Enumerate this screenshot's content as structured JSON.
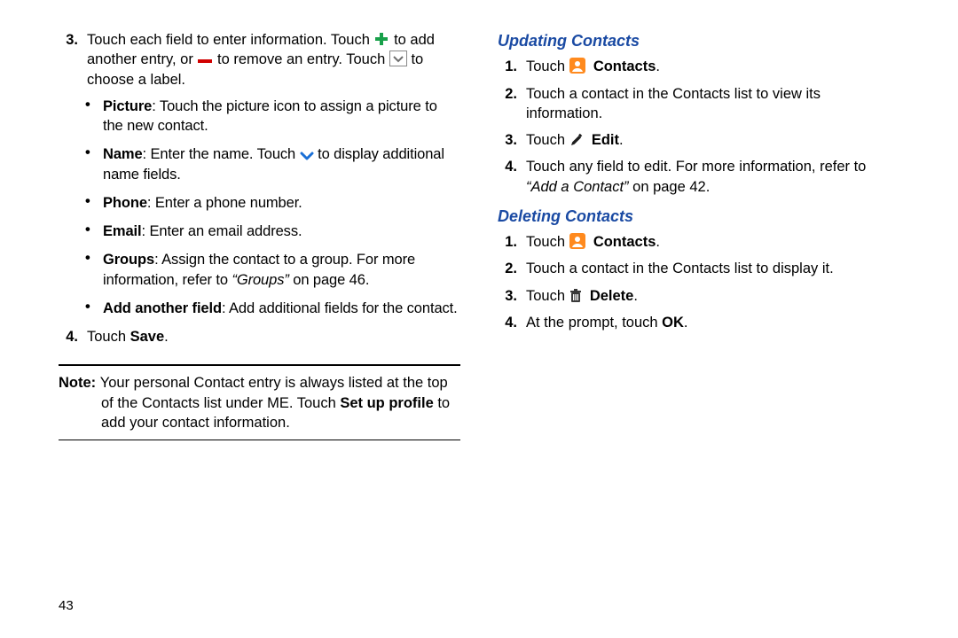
{
  "left": {
    "step3": {
      "num": "3.",
      "l1a": "Touch each field to enter information. Touch ",
      "l1b": " to add",
      "l2a": "another entry, or ",
      "l2b": " to remove an entry. Touch ",
      "l2c": " to",
      "l3": "choose a label."
    },
    "bullets": [
      {
        "label": "Picture",
        "desc": ": Touch the picture icon to assign a picture to the new contact."
      },
      {
        "label": "Name",
        "descA": ": Enter the name. Touch ",
        "descB": " to display additional name fields.",
        "hasChevron": true
      },
      {
        "label": "Phone",
        "desc": ": Enter a phone number."
      },
      {
        "label": "Email",
        "desc": ": Enter an email address."
      },
      {
        "label": "Groups",
        "descA": ": Assign the contact to a group. For more information, refer to ",
        "ref": "“Groups”",
        "descB": " on page 46."
      },
      {
        "label": "Add another field",
        "desc": ": Add additional fields for the contact."
      }
    ],
    "step4": {
      "num": "4.",
      "a": "Touch ",
      "b": "Save",
      "c": "."
    },
    "note": {
      "lead": "Note: ",
      "a": "Your personal Contact entry is always listed at the top of the Contacts list under ME. Touch ",
      "b": "Set up profile",
      "c": " to add your contact information."
    },
    "pagenum": "43"
  },
  "right": {
    "updating": {
      "title": "Updating Contacts",
      "s1": {
        "num": "1.",
        "a": "Touch ",
        "b": "Contacts",
        "c": "."
      },
      "s2": {
        "num": "2.",
        "txt": "Touch a contact in the Contacts list to view its information."
      },
      "s3": {
        "num": "3.",
        "a": "Touch ",
        "b": "Edit",
        "c": "."
      },
      "s4": {
        "num": "4.",
        "a": "Touch any field to edit. For more information, refer to ",
        "ref": "“Add a Contact”",
        "b": " on page 42."
      }
    },
    "deleting": {
      "title": "Deleting Contacts",
      "s1": {
        "num": "1.",
        "a": "Touch ",
        "b": "Contacts",
        "c": "."
      },
      "s2": {
        "num": "2.",
        "txt": "Touch a contact in the Contacts list to display it."
      },
      "s3": {
        "num": "3.",
        "a": "Touch ",
        "b": "Delete",
        "c": "."
      },
      "s4": {
        "num": "4.",
        "a": "At the prompt, touch ",
        "b": "OK",
        "c": "."
      }
    }
  }
}
